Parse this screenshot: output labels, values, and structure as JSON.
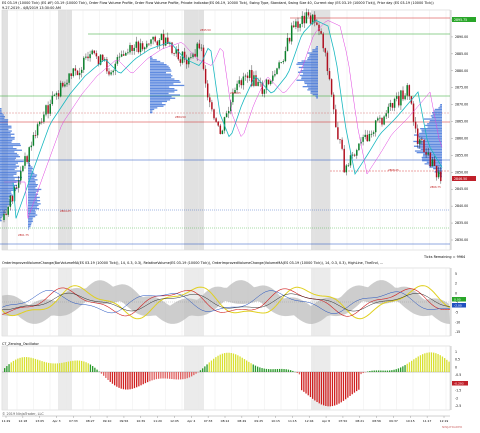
{
  "chart": {
    "title": "ES 03-19 (10000 Tick) (ES #F) 03-19 (10000 Tick), Order Flow Volume Profile, Order Flow Volume Profile, Private Indicator(ES 06-19, 10000 Tick), Swing Type, Standard, Swing Size 40, Current day (ES 03-19 (10000 Tick)), Prior day (ES 03-19 (10000 Tick))",
    "subtitle": "9-27-2019 - 4/8/2019 13:30:00 AM",
    "ticks_remaining_label": "Ticks Remaining = 9964",
    "price_labels": [
      "2895.75",
      "2890.00",
      "2885.00",
      "2880.00",
      "2875.00",
      "2870.00",
      "2865.00",
      "2860.00",
      "2855.00",
      "2850.00",
      "2845.00",
      "2840.00",
      "2835.00",
      "2830.00"
    ],
    "current_price": "2846.50",
    "osc_labels": [
      "5",
      "2",
      "0",
      "-2",
      "-5",
      "-10",
      "-15"
    ],
    "osc_current": "0.00",
    "osc_current_2": "-2.00",
    "hist_labels": [
      "1",
      "0.5",
      "0",
      "-0.5",
      "-1",
      "-1.5",
      "-2",
      "-2.5"
    ],
    "hist_current": "-0.293",
    "time_labels": [
      "11:29",
      "12:18",
      "13:05",
      "Apr 3",
      "07:33",
      "08:27",
      "09:10",
      "09:56",
      "10:39",
      "11:20",
      "12:05",
      "Apr 4",
      "07:33",
      "08:12",
      "08:49",
      "09:25",
      "10:15",
      "11:15",
      "12:04",
      "Apr 8",
      "07:50",
      "08:21",
      "08:56",
      "09:37",
      "10:15",
      "11:17",
      "12:19"
    ],
    "panel2_title": "OrderImprovedVolumeChange(BarVolumeMA(ES 03-19 (10000 Tick)), 14, 0.3, 0.3), RelativeVolume(ES 03-19 (10000 Tick)), OrderImprovedVolumeChange(VolumeMA(ES 03-19 (10000 Tick)), 14, 0.3, 0.3), HighLine, TheEnd, ...",
    "panel3_title": "CT_Zeroing_Oscillator",
    "copyright": "© 2019 NinjaTrader, LLC",
    "watermark": "NINJATRADER"
  },
  "colors": {
    "up": "#0a7f2a",
    "down": "#b01020",
    "profile": "#3a6fd8",
    "price_tag": "#c0202a",
    "grid": "#e8e8e8"
  }
}
